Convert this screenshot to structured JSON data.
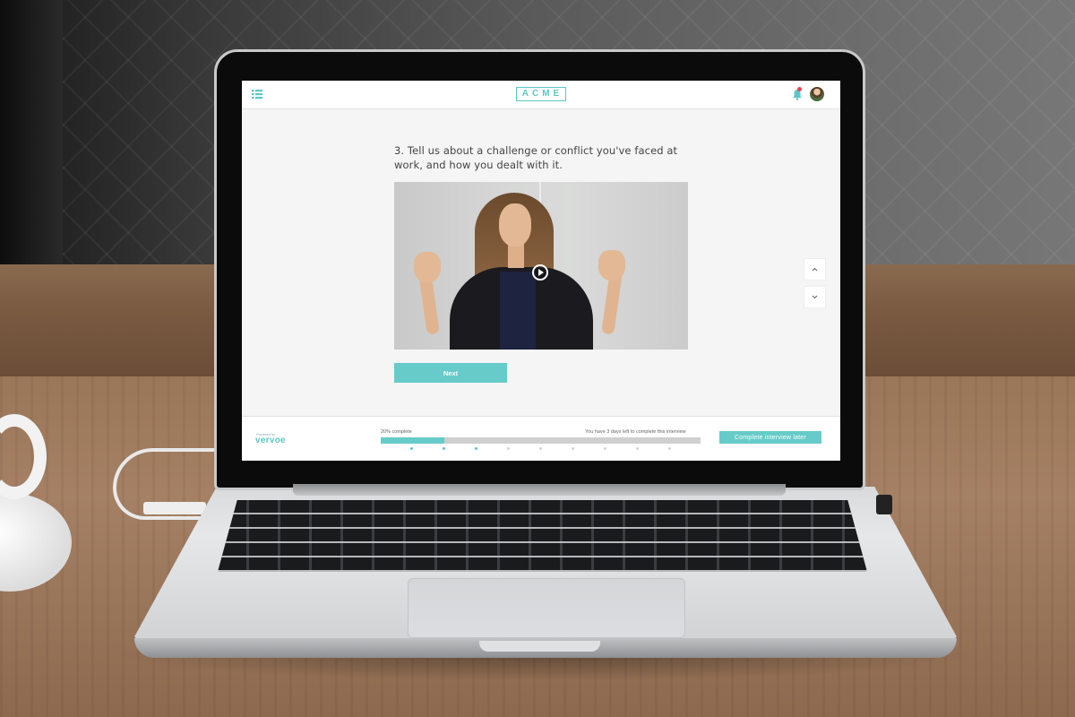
{
  "header": {
    "brand": "ACME",
    "notification_count_indicator": "red-dot",
    "icons": [
      "list-menu-icon",
      "bell-icon",
      "user-avatar"
    ]
  },
  "question": {
    "text": "3. Tell us about a challenge or conflict you've faced at work, and how you dealt with it."
  },
  "video": {
    "play_icon": "play-circle-icon"
  },
  "actions": {
    "next_label": "Next"
  },
  "side_nav": {
    "up_icon": "chevron-up-icon",
    "down_icon": "chevron-down-icon"
  },
  "footer": {
    "powered_by": "Powered by",
    "vendor": "vervoe",
    "progress_label": "20% complete",
    "progress_fraction": 0.2,
    "days_left": "You have 3 days left to complete this interview",
    "complete_later_label": "Complete interview later",
    "step_count": 9,
    "steps_done": 2,
    "current_step": 3
  },
  "colors": {
    "accent": "#66cbc9",
    "brand": "#5ec6c6",
    "badge": "#e54848"
  }
}
